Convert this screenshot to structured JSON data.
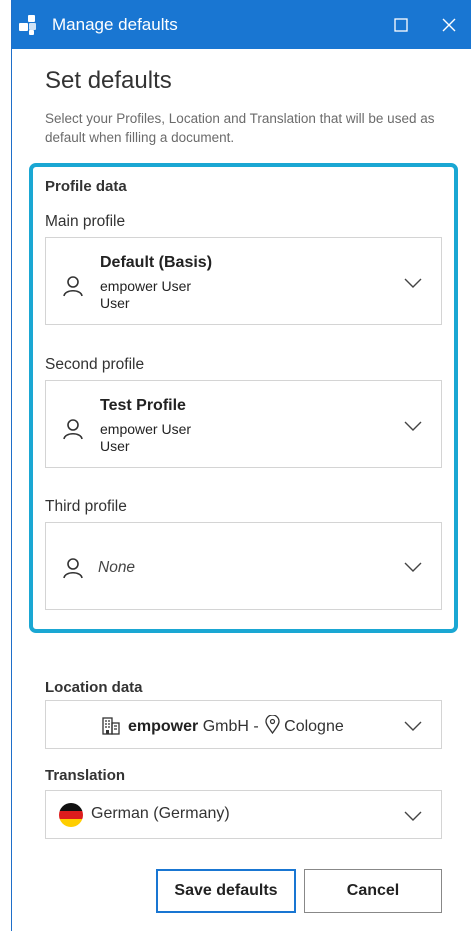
{
  "window": {
    "title": "Manage defaults"
  },
  "heading": "Set defaults",
  "intro": "Select your Profiles, Location and Translation that will be used as default when filling a document.",
  "profile_data": {
    "title": "Profile data",
    "main": {
      "label": "Main profile",
      "name": "Default (Basis)",
      "line1": "empower User",
      "line2": "User"
    },
    "second": {
      "label": "Second profile",
      "name": "Test Profile",
      "line1": "empower User",
      "line2": "User"
    },
    "third": {
      "label": "Third profile",
      "value": "None"
    }
  },
  "location": {
    "title": "Location data",
    "company_bold": "empower",
    "company_rest": " GmbH - ",
    "city": "Cologne"
  },
  "translation": {
    "title": "Translation",
    "value": "German (Germany)"
  },
  "buttons": {
    "save": "Save defaults",
    "cancel": "Cancel"
  },
  "colors": {
    "titlebar": "#1976d2",
    "focus_border": "#1aa7d3",
    "primary_border": "#1976d2"
  },
  "icons": [
    "app-icon",
    "maximize-icon",
    "close-icon",
    "person-icon",
    "chevron-down-icon",
    "building-icon",
    "location-pin-icon",
    "german-flag-icon"
  ]
}
